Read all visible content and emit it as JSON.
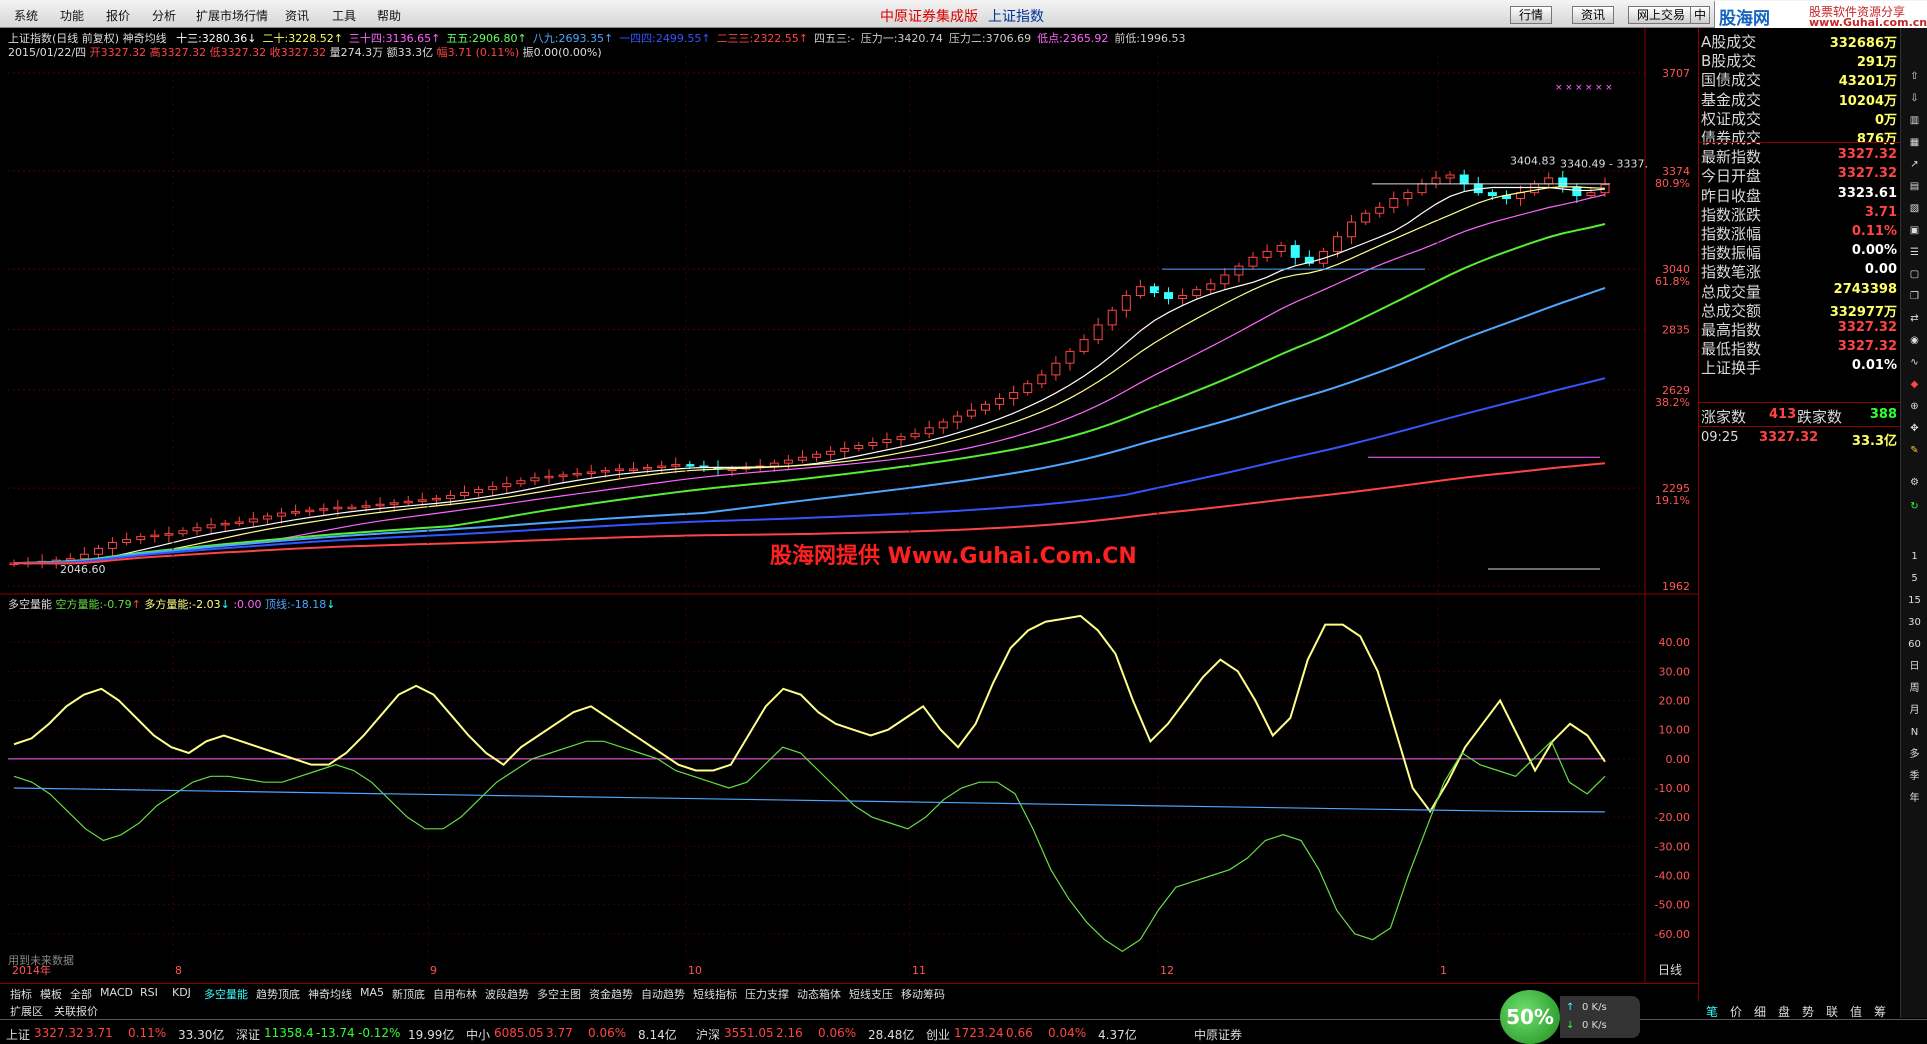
{
  "menu": [
    "系统",
    "功能",
    "报价",
    "分析",
    "扩展市场行情",
    "资讯",
    "工具",
    "帮助"
  ],
  "app_title": "中原证券集成版",
  "index_title": "上证指数",
  "top_buttons": [
    "行情",
    "资讯",
    "网上交易",
    "中"
  ],
  "logo": {
    "big": "股海网",
    "small": "股票软件资源分享",
    "url": "www.Guhai.com.cn"
  },
  "header": {
    "line1_prefix": "上证指数(日线 前复权) 神奇均线",
    "ma": [
      {
        "label": "十三:",
        "value": "3280.36",
        "arrow": "↓",
        "color": "#ffffff"
      },
      {
        "label": "二十:",
        "value": "3228.52",
        "arrow": "↑",
        "color": "#ffff66"
      },
      {
        "label": "三十四:",
        "value": "3136.65",
        "arrow": "↑",
        "color": "#ff66ff"
      },
      {
        "label": "五五:",
        "value": "2906.80",
        "arrow": "↑",
        "color": "#66ff66"
      },
      {
        "label": "八九:",
        "value": "2693.35",
        "arrow": "↑",
        "color": "#4da6ff"
      },
      {
        "label": "一四四:",
        "value": "2499.55",
        "arrow": "↑",
        "color": "#3355ff"
      },
      {
        "label": "二三三:",
        "value": "2322.55",
        "arrow": "↑",
        "color": "#ff4444"
      },
      {
        "label": "四五三:",
        "value": "-",
        "arrow": "",
        "color": "#cccccc"
      },
      {
        "label": "压力一:",
        "value": "3420.74",
        "arrow": "",
        "color": "#cccccc"
      },
      {
        "label": "压力二:",
        "value": "3706.69",
        "arrow": "",
        "color": "#cccccc"
      },
      {
        "label": "低点:",
        "value": "2365.92",
        "arrow": "",
        "color": "#ff66ff"
      },
      {
        "label": "前低:",
        "value": "1996.53",
        "arrow": "",
        "color": "#cccccc"
      }
    ],
    "line2": {
      "date": "2015/01/22/四",
      "open_label": "开",
      "open": "3327.32",
      "high_label": "高",
      "high": "3327.32",
      "low_label": "低",
      "low": "3327.32",
      "close_label": "收",
      "close": "3327.32",
      "vol_label": "量",
      "vol": "274.3万",
      "amt_label": "额",
      "amt": "33.3亿",
      "chg_label": "幅",
      "chg": "3.71 (0.11%)",
      "amp_label": "振",
      "amp": "0.00(0.00%)"
    }
  },
  "price_axis": [
    {
      "label": "3707",
      "sub": ""
    },
    {
      "label": "3374",
      "sub": "80.9%"
    },
    {
      "label": "3040",
      "sub": "61.8%"
    },
    {
      "label": "2835",
      "sub": ""
    },
    {
      "label": "2629",
      "sub": "38.2%"
    },
    {
      "label": "2295",
      "sub": "19.1%"
    },
    {
      "label": "1962",
      "sub": ""
    }
  ],
  "annotations": {
    "low_price": "2046.60",
    "hi1": "3404.83",
    "hi2": "3340.49 - 3337.",
    "watermark": "股海网提供 Www.Guhai.Com.CN"
  },
  "indicator_header": {
    "name": "多空量能",
    "a_label": "空方量能:",
    "a_val": "-0.79",
    "a_arrow": "↑",
    "b_label": "多方量能:",
    "b_val": "-2.03",
    "b_arrow": "↓",
    "c_label": ":",
    "c_val": "0.00",
    "d_label": "顶线:",
    "d_val": "-18.18",
    "d_arrow": "↓"
  },
  "ind_axis": [
    "40.00",
    "30.00",
    "20.00",
    "10.00",
    "0.00",
    "-10.00",
    "-20.00",
    "-30.00",
    "-40.00",
    "-50.00",
    "-60.00"
  ],
  "future_data_note": "用到未来数据",
  "time_axis": [
    {
      "label": "2014年"
    },
    {
      "label": "8"
    },
    {
      "label": "9"
    },
    {
      "label": "10"
    },
    {
      "label": "11"
    },
    {
      "label": "12"
    },
    {
      "label": "1"
    }
  ],
  "period_label": "日线",
  "zoom_ctrl": "+ - 0",
  "tabs": [
    "指标",
    "模板",
    "全部",
    "MACD",
    "RSI",
    "KDJ",
    "多空量能",
    "趋势顶底",
    "神奇均线",
    "MA5",
    "新顶底",
    "自用布林",
    "波段趋势",
    "多空主图",
    "资金趋势",
    "自动趋势",
    "短线指标",
    "压力支撑",
    "动态箱体",
    "短线支压",
    "移动筹码"
  ],
  "tabs2": [
    "扩展区",
    "关联报价"
  ],
  "right_panel": {
    "rows": [
      {
        "label": "A股成交",
        "value": "332686万",
        "color": "#ffff66"
      },
      {
        "label": "B股成交",
        "value": "291万",
        "color": "#ffff66"
      },
      {
        "label": "国债成交",
        "value": "43201万",
        "color": "#ffff66"
      },
      {
        "label": "基金成交",
        "value": "10204万",
        "color": "#ffff66"
      },
      {
        "label": "权证成交",
        "value": "0万",
        "color": "#ffff66"
      },
      {
        "label": "债券成交",
        "value": "876万",
        "color": "#ffff66"
      },
      {
        "label": "最新指数",
        "value": "3327.32",
        "color": "#ff4444"
      },
      {
        "label": "今日开盘",
        "value": "3327.32",
        "color": "#ff4444"
      },
      {
        "label": "昨日收盘",
        "value": "3323.61",
        "color": "#ffffff"
      },
      {
        "label": "指数涨跌",
        "value": "3.71",
        "color": "#ff4444"
      },
      {
        "label": "指数涨幅",
        "value": "0.11%",
        "color": "#ff4444"
      },
      {
        "label": "指数振幅",
        "value": "0.00%",
        "color": "#ffffff"
      },
      {
        "label": "指数笔涨",
        "value": "0.00",
        "color": "#ffffff"
      },
      {
        "label": "总成交量",
        "value": "2743398",
        "color": "#ffff66"
      },
      {
        "label": "总成交额",
        "value": "332977万",
        "color": "#ffff66"
      },
      {
        "label": "最高指数",
        "value": "3327.32",
        "color": "#ff4444"
      },
      {
        "label": "最低指数",
        "value": "3327.32",
        "color": "#ff4444"
      },
      {
        "label": "上证换手",
        "value": "0.01%",
        "color": "#ffffff"
      }
    ],
    "updown": {
      "up_label": "涨家数",
      "up": "413",
      "down_label": "跌家数",
      "down": "388"
    },
    "tick": {
      "time": "09:25",
      "price": "3327.32",
      "amt": "33.3亿"
    }
  },
  "right_bottom_tabs": [
    "笔",
    "价",
    "细",
    "盘",
    "势",
    "联",
    "值",
    "筹"
  ],
  "right_toolbar": [
    "1",
    "5",
    "15",
    "30",
    "60",
    "日",
    "周",
    "月",
    "N",
    "多",
    "季",
    "年"
  ],
  "statusbar": [
    {
      "name": "上证",
      "price": "3327.32",
      "chg": "3.71",
      "pct": "0.11%",
      "amt": "33.30亿",
      "color": "#ff4444"
    },
    {
      "name": "深证",
      "price": "11358.4",
      "chg": "-13.74",
      "pct": "-0.12%",
      "amt": "19.99亿",
      "color": "#33ff33"
    },
    {
      "name": "中小",
      "price": "6085.05",
      "chg": "3.77",
      "pct": "0.06%",
      "amt": "8.14亿",
      "color": "#ff4444"
    },
    {
      "name": "沪深",
      "price": "3551.05",
      "chg": "2.16",
      "pct": "0.06%",
      "amt": "28.48亿",
      "color": "#ff4444"
    },
    {
      "name": "创业",
      "price": "1723.24",
      "chg": "0.66",
      "pct": "0.04%",
      "amt": "4.37亿",
      "color": "#ff4444"
    }
  ],
  "broker": "中原证券",
  "speed": {
    "pct": "50%",
    "up": "0 K/s",
    "down": "0 K/s"
  },
  "colors": {
    "bg": "#000000",
    "border": "#8b0000",
    "up": "#ff4444",
    "down": "#33ffff",
    "yellow_line": "#ffff88",
    "green_line": "#66dd44"
  },
  "chart_data": [
    {
      "type": "candlestick",
      "title": "上证指数(日线 前复权)",
      "ylim": [
        1962,
        3707
      ],
      "ma_series": [
        "十三",
        "二十",
        "三十四",
        "五五",
        "八九",
        "一四四",
        "二三三"
      ],
      "approx_closes": [
        2040,
        2042,
        2046,
        2050,
        2055,
        2070,
        2090,
        2110,
        2120,
        2130,
        2135,
        2140,
        2150,
        2160,
        2170,
        2175,
        2180,
        2190,
        2200,
        2210,
        2215,
        2220,
        2225,
        2230,
        2230,
        2235,
        2240,
        2245,
        2250,
        2255,
        2260,
        2270,
        2280,
        2290,
        2300,
        2310,
        2320,
        2330,
        2335,
        2340,
        2345,
        2350,
        2355,
        2360,
        2360,
        2365,
        2370,
        2375,
        2370,
        2365,
        2360,
        2360,
        2365,
        2370,
        2380,
        2390,
        2400,
        2410,
        2420,
        2430,
        2440,
        2450,
        2460,
        2470,
        2480,
        2500,
        2520,
        2540,
        2560,
        2580,
        2600,
        2620,
        2650,
        2680,
        2720,
        2760,
        2800,
        2850,
        2900,
        2950,
        2980,
        2960,
        2940,
        2950,
        2970,
        2990,
        3020,
        3050,
        3080,
        3100,
        3120,
        3080,
        3060,
        3100,
        3150,
        3200,
        3230,
        3250,
        3280,
        3300,
        3330,
        3350,
        3360,
        3330,
        3300,
        3290,
        3280,
        3300,
        3330,
        3350,
        3320,
        3290,
        3300,
        3327
      ]
    },
    {
      "type": "line",
      "title": "多空量能",
      "ylim": [
        -70,
        50
      ],
      "series": [
        {
          "name": "空方量能",
          "values": [
            5,
            7,
            12,
            18,
            22,
            24,
            20,
            14,
            8,
            4,
            2,
            6,
            8,
            6,
            4,
            2,
            0,
            -2,
            -2,
            2,
            8,
            15,
            22,
            25,
            22,
            15,
            8,
            2,
            -2,
            4,
            8,
            12,
            16,
            18,
            14,
            10,
            6,
            2,
            -2,
            -4,
            -4,
            -2,
            8,
            18,
            24,
            22,
            16,
            12,
            10,
            8,
            10,
            14,
            18,
            10,
            4,
            12,
            26,
            38,
            44,
            47,
            48,
            49,
            44,
            36,
            20,
            6,
            12,
            20,
            28,
            34,
            30,
            20,
            8,
            14,
            34,
            46,
            46,
            42,
            30,
            10,
            -10,
            -18,
            -8,
            4,
            12,
            20,
            8,
            -4,
            6,
            12,
            8,
            -1
          ]
        },
        {
          "name": "多方量能",
          "values": [
            -6,
            -8,
            -12,
            -18,
            -24,
            -28,
            -26,
            -22,
            -16,
            -12,
            -8,
            -6,
            -6,
            -7,
            -8,
            -8,
            -6,
            -4,
            -2,
            -4,
            -8,
            -14,
            -20,
            -24,
            -24,
            -20,
            -14,
            -8,
            -4,
            0,
            2,
            4,
            6,
            6,
            4,
            2,
            0,
            -4,
            -6,
            -8,
            -10,
            -8,
            -2,
            4,
            2,
            -4,
            -10,
            -16,
            -20,
            -22,
            -24,
            -20,
            -14,
            -10,
            -8,
            -8,
            -12,
            -24,
            -38,
            -48,
            -56,
            -62,
            -66,
            -62,
            -52,
            -44,
            -42,
            -40,
            -38,
            -34,
            -28,
            -26,
            -28,
            -38,
            -52,
            -60,
            -62,
            -58,
            -40,
            -24,
            -8,
            2,
            -2,
            -4,
            -6,
            0,
            6,
            -8,
            -12,
            -6
          ]
        },
        {
          "name": "顶线",
          "values": [
            -10,
            -10.5,
            -11,
            -11.5,
            -12,
            -12.5,
            -13,
            -13.5,
            -14,
            -14.5,
            -15,
            -15.5,
            -16,
            -16.5,
            -17,
            -17.5,
            -18,
            -18.18
          ]
        }
      ]
    }
  ]
}
